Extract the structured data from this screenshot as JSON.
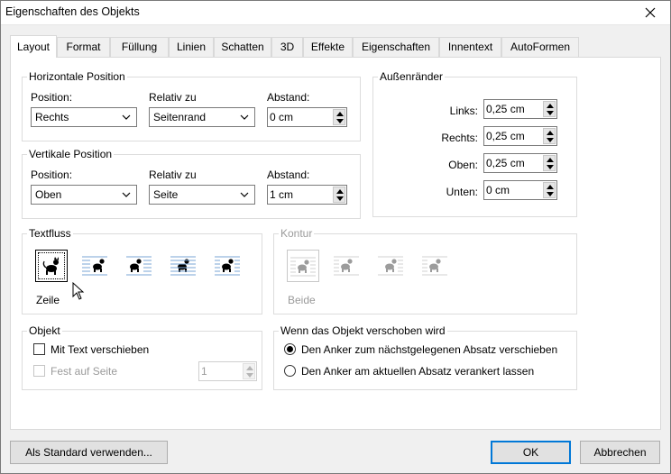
{
  "window": {
    "title": "Eigenschaften des Objekts",
    "close_icon": "close-icon"
  },
  "tabs": [
    {
      "label": "Layout",
      "active": true
    },
    {
      "label": "Format"
    },
    {
      "label": "Füllung"
    },
    {
      "label": "Linien"
    },
    {
      "label": "Schatten"
    },
    {
      "label": "3D"
    },
    {
      "label": "Effekte"
    },
    {
      "label": "Eigenschaften"
    },
    {
      "label": "Innentext"
    },
    {
      "label": "AutoFormen"
    }
  ],
  "horizontal": {
    "legend": "Horizontale Position",
    "position_label": "Position:",
    "position_value": "Rechts",
    "relative_label": "Relativ zu",
    "relative_value": "Seitenrand",
    "distance_label": "Abstand:",
    "distance_value": "0 cm"
  },
  "vertical": {
    "legend": "Vertikale Position",
    "position_label": "Position:",
    "position_value": "Oben",
    "relative_label": "Relativ zu",
    "relative_value": "Seite",
    "distance_label": "Abstand:",
    "distance_value": "1 cm"
  },
  "margins": {
    "legend": "Außenränder",
    "left_label": "Links:",
    "left_value": "0,25 cm",
    "right_label": "Rechts:",
    "right_value": "0,25 cm",
    "top_label": "Oben:",
    "top_value": "0,25 cm",
    "bottom_label": "Unten:",
    "bottom_value": "0 cm"
  },
  "textflow": {
    "legend": "Textfluss",
    "selected_label": "Zeile",
    "options": [
      "wrap-line-icon",
      "wrap-left-icon",
      "wrap-right-icon",
      "wrap-through-icon",
      "wrap-parallel-icon"
    ]
  },
  "contour": {
    "legend": "Kontur",
    "selected_label": "Beide",
    "options": [
      "contour-both-icon",
      "contour-left-icon",
      "contour-right-icon",
      "contour-none-icon"
    ]
  },
  "object": {
    "legend": "Objekt",
    "move_with_text_label": "Mit Text verschieben",
    "fixed_on_page_label": "Fest auf Seite",
    "page_value": "1"
  },
  "move_behavior": {
    "legend": "Wenn das Objekt verschoben wird",
    "option1": "Den Anker zum nächstgelegenen Absatz verschieben",
    "option2": "Den Anker am aktuellen Absatz verankert lassen"
  },
  "buttons": {
    "default": "Als Standard verwenden...",
    "ok": "OK",
    "cancel": "Abbrechen"
  },
  "colors": {
    "focus_border": "#0078d7",
    "panel_bg": "#ffffff",
    "dialog_bg": "#f0f0f0"
  }
}
